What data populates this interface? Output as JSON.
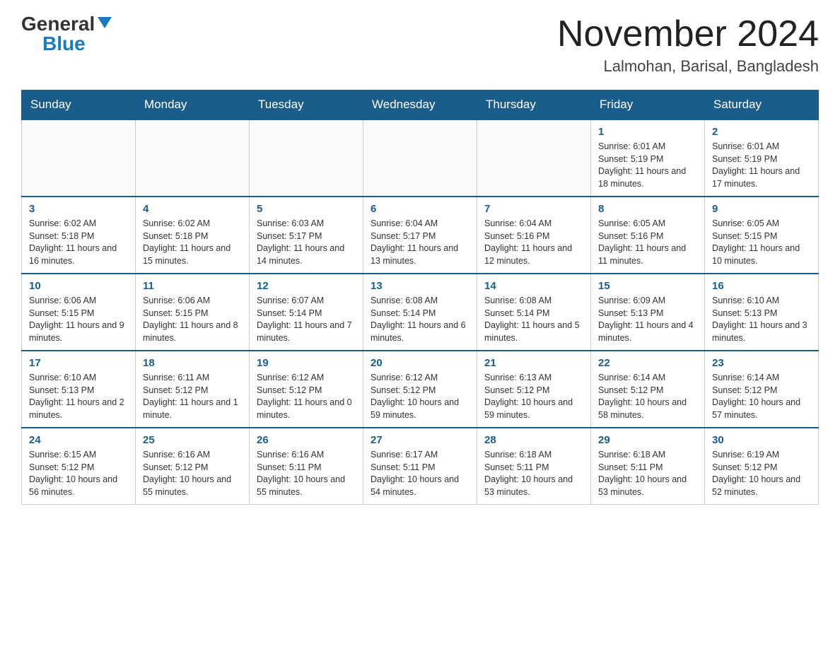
{
  "logo": {
    "general": "General",
    "blue": "Blue"
  },
  "title": "November 2024",
  "subtitle": "Lalmohan, Barisal, Bangladesh",
  "days_of_week": [
    "Sunday",
    "Monday",
    "Tuesday",
    "Wednesday",
    "Thursday",
    "Friday",
    "Saturday"
  ],
  "weeks": [
    [
      {
        "day": "",
        "info": ""
      },
      {
        "day": "",
        "info": ""
      },
      {
        "day": "",
        "info": ""
      },
      {
        "day": "",
        "info": ""
      },
      {
        "day": "",
        "info": ""
      },
      {
        "day": "1",
        "info": "Sunrise: 6:01 AM\nSunset: 5:19 PM\nDaylight: 11 hours and 18 minutes."
      },
      {
        "day": "2",
        "info": "Sunrise: 6:01 AM\nSunset: 5:19 PM\nDaylight: 11 hours and 17 minutes."
      }
    ],
    [
      {
        "day": "3",
        "info": "Sunrise: 6:02 AM\nSunset: 5:18 PM\nDaylight: 11 hours and 16 minutes."
      },
      {
        "day": "4",
        "info": "Sunrise: 6:02 AM\nSunset: 5:18 PM\nDaylight: 11 hours and 15 minutes."
      },
      {
        "day": "5",
        "info": "Sunrise: 6:03 AM\nSunset: 5:17 PM\nDaylight: 11 hours and 14 minutes."
      },
      {
        "day": "6",
        "info": "Sunrise: 6:04 AM\nSunset: 5:17 PM\nDaylight: 11 hours and 13 minutes."
      },
      {
        "day": "7",
        "info": "Sunrise: 6:04 AM\nSunset: 5:16 PM\nDaylight: 11 hours and 12 minutes."
      },
      {
        "day": "8",
        "info": "Sunrise: 6:05 AM\nSunset: 5:16 PM\nDaylight: 11 hours and 11 minutes."
      },
      {
        "day": "9",
        "info": "Sunrise: 6:05 AM\nSunset: 5:15 PM\nDaylight: 11 hours and 10 minutes."
      }
    ],
    [
      {
        "day": "10",
        "info": "Sunrise: 6:06 AM\nSunset: 5:15 PM\nDaylight: 11 hours and 9 minutes."
      },
      {
        "day": "11",
        "info": "Sunrise: 6:06 AM\nSunset: 5:15 PM\nDaylight: 11 hours and 8 minutes."
      },
      {
        "day": "12",
        "info": "Sunrise: 6:07 AM\nSunset: 5:14 PM\nDaylight: 11 hours and 7 minutes."
      },
      {
        "day": "13",
        "info": "Sunrise: 6:08 AM\nSunset: 5:14 PM\nDaylight: 11 hours and 6 minutes."
      },
      {
        "day": "14",
        "info": "Sunrise: 6:08 AM\nSunset: 5:14 PM\nDaylight: 11 hours and 5 minutes."
      },
      {
        "day": "15",
        "info": "Sunrise: 6:09 AM\nSunset: 5:13 PM\nDaylight: 11 hours and 4 minutes."
      },
      {
        "day": "16",
        "info": "Sunrise: 6:10 AM\nSunset: 5:13 PM\nDaylight: 11 hours and 3 minutes."
      }
    ],
    [
      {
        "day": "17",
        "info": "Sunrise: 6:10 AM\nSunset: 5:13 PM\nDaylight: 11 hours and 2 minutes."
      },
      {
        "day": "18",
        "info": "Sunrise: 6:11 AM\nSunset: 5:12 PM\nDaylight: 11 hours and 1 minute."
      },
      {
        "day": "19",
        "info": "Sunrise: 6:12 AM\nSunset: 5:12 PM\nDaylight: 11 hours and 0 minutes."
      },
      {
        "day": "20",
        "info": "Sunrise: 6:12 AM\nSunset: 5:12 PM\nDaylight: 10 hours and 59 minutes."
      },
      {
        "day": "21",
        "info": "Sunrise: 6:13 AM\nSunset: 5:12 PM\nDaylight: 10 hours and 59 minutes."
      },
      {
        "day": "22",
        "info": "Sunrise: 6:14 AM\nSunset: 5:12 PM\nDaylight: 10 hours and 58 minutes."
      },
      {
        "day": "23",
        "info": "Sunrise: 6:14 AM\nSunset: 5:12 PM\nDaylight: 10 hours and 57 minutes."
      }
    ],
    [
      {
        "day": "24",
        "info": "Sunrise: 6:15 AM\nSunset: 5:12 PM\nDaylight: 10 hours and 56 minutes."
      },
      {
        "day": "25",
        "info": "Sunrise: 6:16 AM\nSunset: 5:12 PM\nDaylight: 10 hours and 55 minutes."
      },
      {
        "day": "26",
        "info": "Sunrise: 6:16 AM\nSunset: 5:11 PM\nDaylight: 10 hours and 55 minutes."
      },
      {
        "day": "27",
        "info": "Sunrise: 6:17 AM\nSunset: 5:11 PM\nDaylight: 10 hours and 54 minutes."
      },
      {
        "day": "28",
        "info": "Sunrise: 6:18 AM\nSunset: 5:11 PM\nDaylight: 10 hours and 53 minutes."
      },
      {
        "day": "29",
        "info": "Sunrise: 6:18 AM\nSunset: 5:11 PM\nDaylight: 10 hours and 53 minutes."
      },
      {
        "day": "30",
        "info": "Sunrise: 6:19 AM\nSunset: 5:12 PM\nDaylight: 10 hours and 52 minutes."
      }
    ]
  ]
}
